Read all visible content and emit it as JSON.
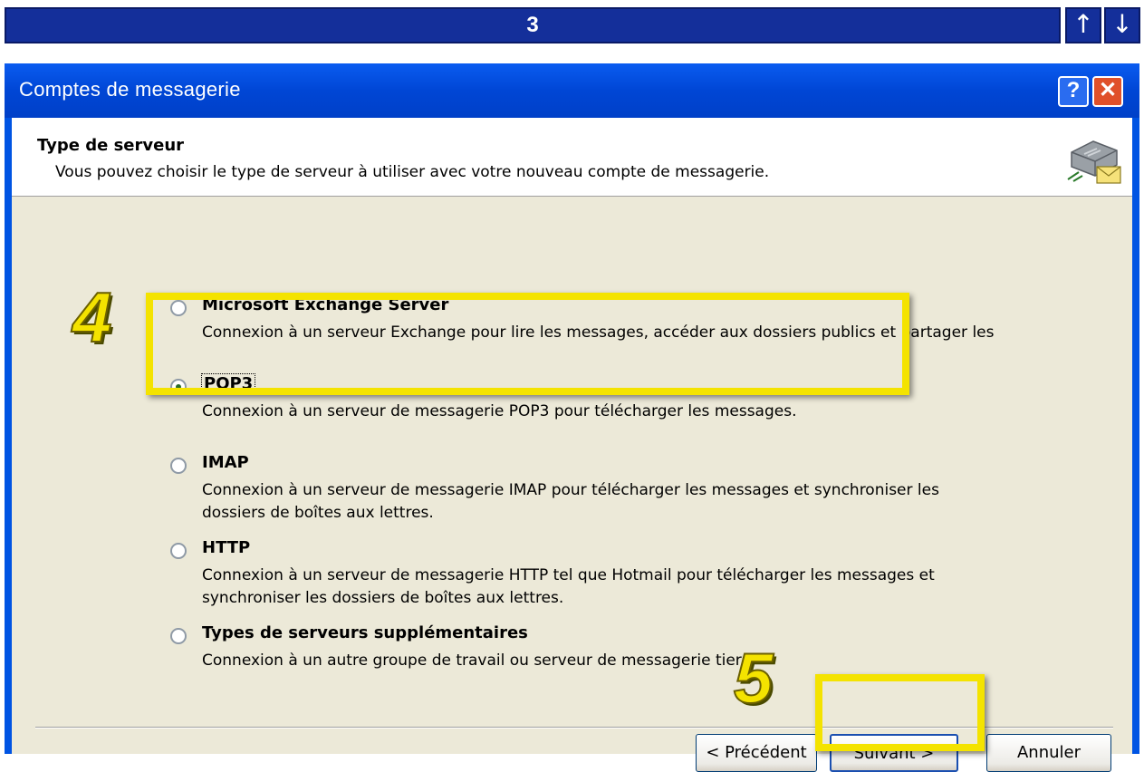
{
  "step_bar": {
    "step_number": "3",
    "up_arrow": "↑",
    "down_arrow": "↓"
  },
  "window": {
    "title": "Comptes de messagerie",
    "help_symbol": "?",
    "close_symbol": "✕"
  },
  "header": {
    "title": "Type de serveur",
    "description": "Vous pouvez choisir le type de serveur à utiliser avec votre nouveau compte de messagerie.",
    "icon": "mail-server-icon"
  },
  "options": [
    {
      "label": "Microsoft Exchange Server",
      "description": "Connexion à un serveur Exchange pour lire les messages, accéder aux dossiers publics et partager les documents.",
      "selected": false
    },
    {
      "label": "POP3",
      "description": "Connexion à un serveur de messagerie POP3 pour télécharger les messages.",
      "selected": true
    },
    {
      "label": "IMAP",
      "description": "Connexion à un serveur de messagerie IMAP pour télécharger les messages et synchroniser les dossiers de boîtes aux lettres.",
      "selected": false
    },
    {
      "label": "HTTP",
      "description": "Connexion à un serveur de messagerie HTTP tel que Hotmail pour télécharger les messages et synchroniser les dossiers de boîtes aux lettres.",
      "selected": false
    },
    {
      "label": "Types de serveurs supplémentaires",
      "description": "Connexion à un autre groupe de travail ou serveur de messagerie tiers.",
      "selected": false
    }
  ],
  "buttons": {
    "previous": "< Précédent",
    "next": "Suivant >",
    "cancel": "Annuler"
  },
  "annotations": {
    "step_4": "4",
    "step_5": "5"
  },
  "colors": {
    "highlight": "#f4e300",
    "title_bar": "#0054e3",
    "step_bar": "#142f9a",
    "dialog_bg": "#ece9d8"
  }
}
